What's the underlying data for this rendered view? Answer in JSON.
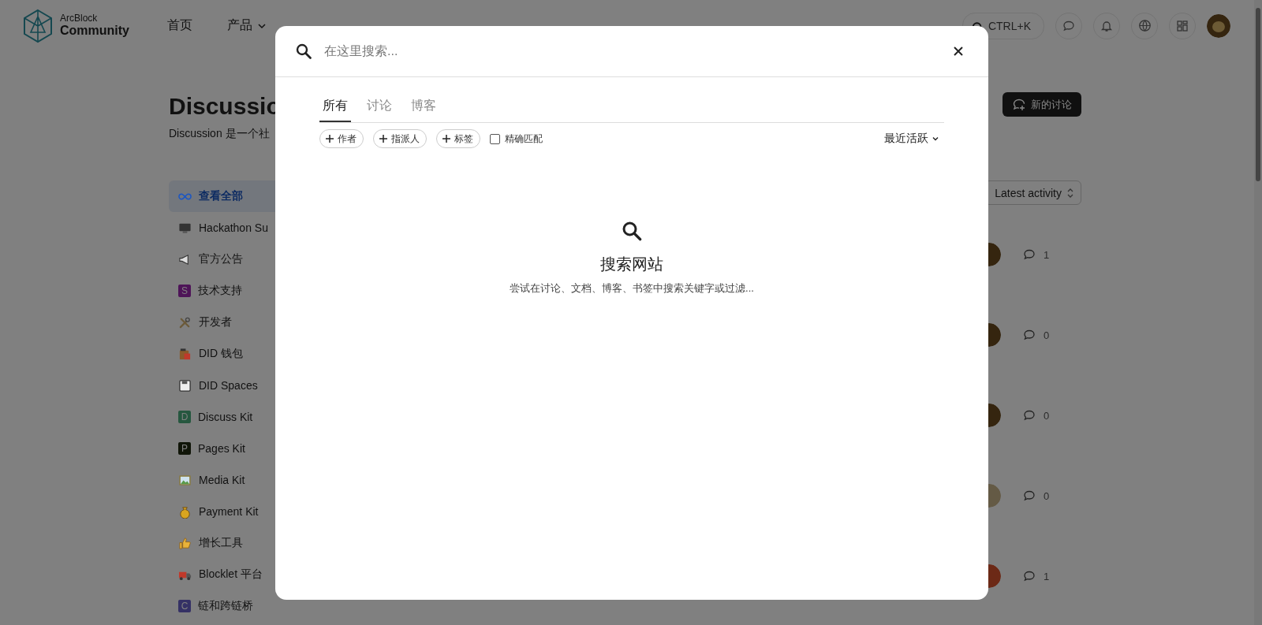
{
  "header": {
    "logo": {
      "line1": "ArcBlock",
      "line2": "Community"
    },
    "nav": [
      {
        "label": "首页",
        "dropdown": false
      },
      {
        "label": "产品",
        "dropdown": true
      }
    ],
    "search": {
      "shortcut": "CTRL+K"
    }
  },
  "page": {
    "title": "Discussio",
    "subtitle": "Discussion 是一个社",
    "new_button": "新的讨论",
    "sort": "Latest activity"
  },
  "sidebar": {
    "items": [
      {
        "label": "查看全部",
        "kind": "infinity",
        "selected": true
      },
      {
        "label": "Hackathon Su",
        "kind": "monitor",
        "selected": false
      },
      {
        "label": "官方公告",
        "kind": "megaphone",
        "selected": false
      },
      {
        "label": "技术支持",
        "kind": "letter",
        "letter": "S",
        "color": "#4e1458",
        "selected": false
      },
      {
        "label": "开发者",
        "kind": "tools",
        "selected": false
      },
      {
        "label": "DID 钱包",
        "kind": "wallet",
        "selected": false
      },
      {
        "label": "DID Spaces",
        "kind": "floppy",
        "selected": false
      },
      {
        "label": "Discuss Kit",
        "kind": "letter",
        "letter": "D",
        "color": "#26573f",
        "selected": false
      },
      {
        "label": "Pages Kit",
        "kind": "letter",
        "letter": "P",
        "color": "#101508",
        "selected": false
      },
      {
        "label": "Media Kit",
        "kind": "image",
        "selected": false
      },
      {
        "label": "Payment Kit",
        "kind": "moneybag",
        "selected": false
      },
      {
        "label": "增长工具",
        "kind": "thumb",
        "selected": false
      },
      {
        "label": "Blocklet 平台",
        "kind": "truck",
        "selected": false
      },
      {
        "label": "链和跨链桥",
        "kind": "letter",
        "letter": "C",
        "color": "#353165",
        "selected": false
      }
    ]
  },
  "rows": [
    {
      "comments": "1",
      "color": "#35250f"
    },
    {
      "comments": "0",
      "color": "#35250f"
    },
    {
      "comments": "0",
      "color": "#35250f"
    },
    {
      "comments": "0",
      "color": "#645a45"
    },
    {
      "comments": "1",
      "color": "#6c2916"
    }
  ],
  "search_modal": {
    "placeholder": "在这里搜索...",
    "tabs": [
      {
        "label": "所有",
        "selected": true
      },
      {
        "label": "讨论",
        "selected": false
      },
      {
        "label": "博客",
        "selected": false
      }
    ],
    "filters": [
      {
        "label": "作者"
      },
      {
        "label": "指派人"
      },
      {
        "label": "标签"
      }
    ],
    "exact_match": {
      "label": "精确匹配",
      "checked": false
    },
    "sort": "最近活跃",
    "empty": {
      "title": "搜索网站",
      "description": "尝试在讨论、文档、博客、书签中搜索关键字或过滤..."
    }
  }
}
